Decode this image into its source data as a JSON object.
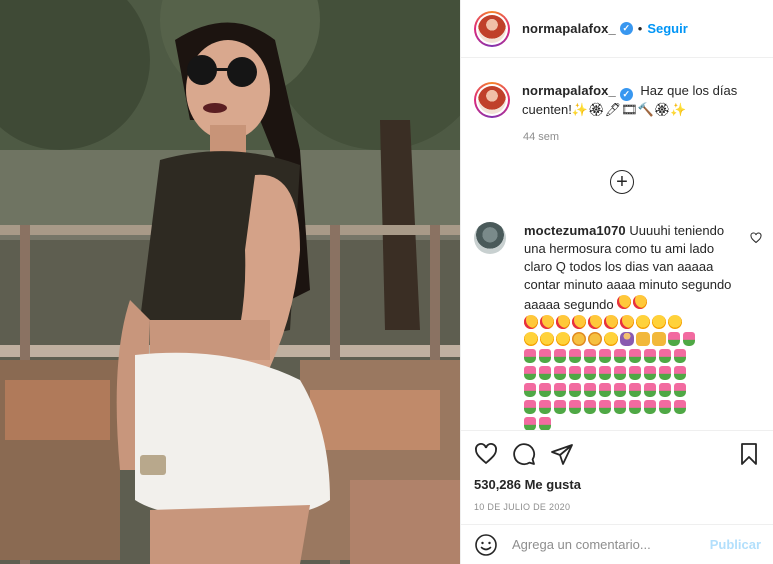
{
  "post": {
    "image_alt": "Mujer con lentes de sol y shorts blancos frente a corral de madera",
    "username": "normapalafox_",
    "verified_icon": "✓",
    "follow_separator": "•",
    "follow_label": "Seguir"
  },
  "caption": {
    "username": "normapalafox_",
    "text": "Haz que los días cuenten!✨🏵🖊🎞🔨🏵✨",
    "time": "44 sem"
  },
  "load_more": {
    "icon": "plus-circle-icon",
    "symbol": "+"
  },
  "comment": {
    "username": "moctezuma1070",
    "text": "Uuuuhi teniendo una hermosura como tu ami lado claro Q todos los dias van aaaaa contar minuto aaaa minuto segundo aaaaa segundo",
    "emojis_first_line": [
      "heart-eyes",
      "heart-eyes"
    ],
    "emojis_row2": [
      "heart-eyes",
      "heart-eyes",
      "heart-eyes",
      "heart-eyes",
      "heart-eyes",
      "heart-eyes",
      "heart-eyes",
      "face",
      "face",
      "face"
    ],
    "emojis_row3": [
      "face",
      "face",
      "face",
      "cat",
      "cat",
      "face",
      "person",
      "hands",
      "hands",
      "tulip",
      "tulip"
    ],
    "tulip_rows": 4,
    "tulips_per_row": 11,
    "last_row_tulips": 2
  },
  "actions": {
    "icons": [
      "heart-icon",
      "comment-icon",
      "share-icon",
      "bookmark-icon"
    ],
    "likes": "530,286 Me gusta",
    "date": "10 DE JULIO DE 2020"
  },
  "composer": {
    "emoji_icon": "smiley-icon",
    "placeholder": "Agrega un comentario...",
    "publish_label": "Publicar"
  },
  "colors": {
    "accent": "#0095f6",
    "verified": "#3897f0",
    "publish_disabled": "#b2dffc",
    "muted": "#8e8e8e",
    "text": "#262626"
  }
}
